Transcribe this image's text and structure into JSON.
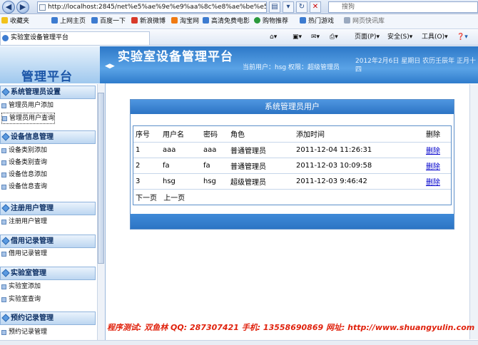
{
  "browser": {
    "url": "http://localhost:2845/net%e5%ae%9e%e9%aa%8c%e8%ae%be%e5%a4%",
    "search_placeholder": "搜狗",
    "favorites_label": "收藏夹",
    "favorites": [
      "上网主页",
      "百度一下",
      "新浪微博",
      "淘宝网",
      "高清免费电影",
      "购物推荐",
      "热门游戏",
      "网页快讯库"
    ],
    "tab_title": "实验室设备管理平台",
    "commands": [
      "页面(P)",
      "安全(S)",
      "工具(O)"
    ]
  },
  "header": {
    "logo_text": "管理平台",
    "system_title": "实验室设备管理平台",
    "user_info": "当前用户：hsg 权限：超级管理员",
    "date_text": "2012年2月6日 星期日 农历壬辰年 正月十四"
  },
  "sidebar": {
    "groups": [
      {
        "title": "系统管理员设置",
        "items": [
          "管理员用户添加",
          "管理员用户查询"
        ]
      },
      {
        "title": "设备信息管理",
        "items": [
          "设备类别添加",
          "设备类别查询",
          "设备信息添加",
          "设备信息查询"
        ]
      },
      {
        "title": "注册用户管理",
        "items": [
          "注册用户管理"
        ]
      },
      {
        "title": "借用记录管理",
        "items": [
          "借用记录管理"
        ]
      },
      {
        "title": "实验室管理",
        "items": [
          "实验室添加",
          "实验室查询"
        ]
      },
      {
        "title": "预约记录管理",
        "items": [
          "预约记录管理"
        ]
      }
    ]
  },
  "main": {
    "panel_title": "系统管理员用户",
    "columns": [
      "序号",
      "用户名",
      "密码",
      "角色",
      "添加时间",
      "删除"
    ],
    "rows": [
      [
        "1",
        "aaa",
        "aaa",
        "普通管理员",
        "2011-12-04 11:26:31",
        "删除"
      ],
      [
        "2",
        "fa",
        "fa",
        "普通管理员",
        "2011-12-03 10:09:58",
        "删除"
      ],
      [
        "3",
        "hsg",
        "hsg",
        "超级管理员",
        "2011-12-03 9:46:42",
        "删除"
      ]
    ],
    "pager_next": "下一页",
    "pager_prev": "上一页"
  },
  "footer": {
    "text": "程序测试: 双鱼林   QQ: 287307421   手机: 13558690869   网址: http://www.shuangyulin.com"
  }
}
